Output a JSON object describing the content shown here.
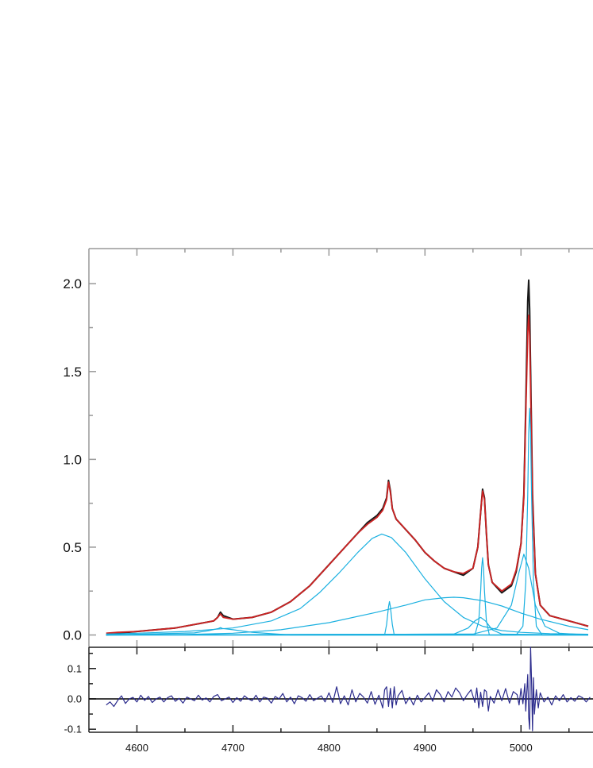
{
  "chart_data": [
    {
      "type": "line",
      "title": "",
      "xlabel": "",
      "ylabel": "",
      "xlim": [
        4550,
        5075
      ],
      "ylim": [
        -0.07,
        2.2
      ],
      "x_ticks": [
        4600,
        4700,
        4800,
        4900,
        5000
      ],
      "y_ticks": [
        0.0,
        0.5,
        1.0,
        1.5,
        2.0
      ],
      "y_tick_labels": [
        "0.0",
        "0.5",
        "1.0",
        "1.5",
        "2.0"
      ],
      "grid": false,
      "legend": "none",
      "series": [
        {
          "role": "observed",
          "color": "#1a1a1a",
          "x": [
            4568,
            4580,
            4600,
            4620,
            4640,
            4660,
            4680,
            4684,
            4687,
            4690,
            4700,
            4720,
            4740,
            4760,
            4780,
            4800,
            4820,
            4830,
            4840,
            4850,
            4856,
            4860,
            4862,
            4864,
            4866,
            4870,
            4880,
            4890,
            4900,
            4910,
            4920,
            4930,
            4940,
            4950,
            4955,
            4958,
            4960,
            4962,
            4964,
            4966,
            4970,
            4980,
            4990,
            4995,
            5000,
            5003,
            5005,
            5007,
            5008,
            5009,
            5010,
            5012,
            5015,
            5020,
            5030,
            5050,
            5070
          ],
          "y": [
            0.0,
            0.01,
            0.02,
            0.03,
            0.04,
            0.06,
            0.08,
            0.1,
            0.13,
            0.11,
            0.09,
            0.1,
            0.13,
            0.19,
            0.28,
            0.4,
            0.52,
            0.58,
            0.64,
            0.68,
            0.72,
            0.78,
            0.88,
            0.82,
            0.72,
            0.66,
            0.6,
            0.54,
            0.47,
            0.42,
            0.38,
            0.36,
            0.34,
            0.38,
            0.5,
            0.7,
            0.83,
            0.78,
            0.58,
            0.4,
            0.3,
            0.24,
            0.28,
            0.36,
            0.52,
            0.8,
            1.3,
            1.9,
            2.02,
            1.85,
            1.5,
            0.8,
            0.35,
            0.17,
            0.11,
            0.08,
            0.05
          ]
        },
        {
          "role": "fit",
          "color": "#cc2222",
          "x": [
            4568,
            4580,
            4600,
            4620,
            4640,
            4660,
            4680,
            4684,
            4687,
            4690,
            4700,
            4720,
            4740,
            4760,
            4780,
            4800,
            4820,
            4830,
            4840,
            4850,
            4856,
            4860,
            4862,
            4864,
            4866,
            4870,
            4880,
            4890,
            4900,
            4910,
            4920,
            4930,
            4940,
            4950,
            4955,
            4958,
            4960,
            4962,
            4964,
            4966,
            4970,
            4980,
            4990,
            4995,
            5000,
            5003,
            5005,
            5007,
            5008,
            5009,
            5010,
            5012,
            5015,
            5020,
            5030,
            5050,
            5070
          ],
          "y": [
            0.01,
            0.015,
            0.02,
            0.03,
            0.04,
            0.06,
            0.08,
            0.1,
            0.12,
            0.1,
            0.09,
            0.1,
            0.13,
            0.19,
            0.28,
            0.4,
            0.52,
            0.58,
            0.63,
            0.67,
            0.71,
            0.77,
            0.87,
            0.81,
            0.72,
            0.66,
            0.6,
            0.54,
            0.47,
            0.42,
            0.38,
            0.36,
            0.35,
            0.38,
            0.5,
            0.7,
            0.82,
            0.77,
            0.58,
            0.4,
            0.3,
            0.25,
            0.29,
            0.37,
            0.52,
            0.78,
            1.25,
            1.72,
            1.82,
            1.7,
            1.4,
            0.78,
            0.35,
            0.17,
            0.11,
            0.08,
            0.05
          ]
        },
        {
          "role": "component",
          "color": "#1ab0e0",
          "x": [
            4568,
            4600,
            4650,
            4700,
            4740,
            4770,
            4790,
            4810,
            4830,
            4845,
            4855,
            4865,
            4880,
            4900,
            4920,
            4940,
            4960,
            4980,
            5000,
            5030,
            5070
          ],
          "y": [
            0.005,
            0.01,
            0.02,
            0.04,
            0.08,
            0.15,
            0.24,
            0.35,
            0.47,
            0.55,
            0.575,
            0.555,
            0.47,
            0.32,
            0.19,
            0.1,
            0.05,
            0.025,
            0.015,
            0.008,
            0.004
          ]
        },
        {
          "role": "component",
          "color": "#1ab0e0",
          "x": [
            4568,
            4650,
            4700,
            4750,
            4800,
            4850,
            4880,
            4900,
            4920,
            4930,
            4940,
            4960,
            4980,
            5000,
            5020,
            5050,
            5070
          ],
          "y": [
            0.0,
            0.003,
            0.01,
            0.03,
            0.07,
            0.13,
            0.17,
            0.2,
            0.212,
            0.215,
            0.212,
            0.195,
            0.165,
            0.125,
            0.09,
            0.05,
            0.03
          ]
        },
        {
          "role": "component",
          "color": "#1ab0e0",
          "x": [
            4568,
            4660,
            4675,
            4685,
            4687,
            4689,
            4700,
            4720,
            4760,
            5070
          ],
          "y": [
            0.0,
            0.012,
            0.025,
            0.037,
            0.042,
            0.037,
            0.03,
            0.015,
            0.0,
            0.0
          ]
        },
        {
          "role": "component",
          "color": "#1ab0e0",
          "x": [
            4568,
            4858,
            4860,
            4862,
            4863,
            4864,
            4866,
            4868,
            5070
          ],
          "y": [
            0.0,
            0.0,
            0.06,
            0.16,
            0.19,
            0.16,
            0.06,
            0.0,
            0.0
          ]
        },
        {
          "role": "component",
          "color": "#1ab0e0",
          "x": [
            4568,
            4952,
            4956,
            4958,
            4959,
            4960,
            4961,
            4962,
            4964,
            4967,
            5070
          ],
          "y": [
            0.0,
            0.0,
            0.08,
            0.25,
            0.38,
            0.44,
            0.38,
            0.25,
            0.08,
            0.0,
            0.0
          ]
        },
        {
          "role": "component",
          "color": "#1ab0e0",
          "x": [
            4568,
            4930,
            4945,
            4952,
            4958,
            4963,
            4970,
            4980,
            5070
          ],
          "y": [
            0.0,
            0.005,
            0.04,
            0.08,
            0.1,
            0.08,
            0.03,
            0.005,
            0.0
          ]
        },
        {
          "role": "component",
          "color": "#1ab0e0",
          "x": [
            4568,
            4995,
            5002,
            5005,
            5007,
            5008,
            5009,
            5010,
            5011,
            5013,
            5016,
            5022,
            5070
          ],
          "y": [
            0.0,
            0.0,
            0.05,
            0.3,
            0.8,
            1.15,
            1.29,
            1.15,
            0.8,
            0.3,
            0.05,
            0.0,
            0.0
          ]
        },
        {
          "role": "component",
          "color": "#1ab0e0",
          "x": [
            4568,
            4950,
            4975,
            4990,
            4998,
            5003,
            5008,
            5015,
            5025,
            5040,
            5070
          ],
          "y": [
            0.0,
            0.005,
            0.04,
            0.17,
            0.36,
            0.46,
            0.38,
            0.17,
            0.05,
            0.01,
            0.0
          ]
        }
      ]
    },
    {
      "type": "line",
      "title": "",
      "xlabel": "",
      "ylabel": "",
      "xlim": [
        4550,
        5075
      ],
      "ylim": [
        -0.11,
        0.17
      ],
      "x_ticks": [
        4600,
        4700,
        4800,
        4900,
        5000
      ],
      "x_tick_labels": [
        "4600",
        "4700",
        "4800",
        "4900",
        "5000"
      ],
      "y_ticks": [
        -0.1,
        0.0,
        0.1
      ],
      "y_tick_labels": [
        "-0.1",
        "0.0",
        "0.1"
      ],
      "grid": false,
      "legend": "none",
      "series": [
        {
          "role": "zero-line",
          "color": "#000000",
          "x": [
            4550,
            5075
          ],
          "y": [
            0,
            0
          ]
        },
        {
          "role": "residual",
          "color": "#2a2a8c",
          "x": [
            4568,
            4572,
            4576,
            4580,
            4584,
            4588,
            4592,
            4596,
            4600,
            4604,
            4608,
            4612,
            4616,
            4620,
            4624,
            4628,
            4632,
            4636,
            4640,
            4644,
            4648,
            4652,
            4656,
            4660,
            4664,
            4668,
            4672,
            4676,
            4680,
            4684,
            4688,
            4692,
            4696,
            4700,
            4704,
            4708,
            4712,
            4716,
            4720,
            4724,
            4728,
            4732,
            4736,
            4740,
            4744,
            4748,
            4752,
            4756,
            4760,
            4764,
            4768,
            4772,
            4776,
            4780,
            4784,
            4788,
            4792,
            4796,
            4800,
            4804,
            4808,
            4812,
            4816,
            4820,
            4824,
            4828,
            4832,
            4836,
            4840,
            4844,
            4848,
            4852,
            4856,
            4858,
            4860,
            4862,
            4864,
            4866,
            4868,
            4870,
            4872,
            4876,
            4880,
            4884,
            4888,
            4892,
            4896,
            4900,
            4904,
            4908,
            4912,
            4916,
            4920,
            4924,
            4928,
            4932,
            4936,
            4940,
            4944,
            4948,
            4952,
            4954,
            4956,
            4958,
            4960,
            4962,
            4964,
            4966,
            4968,
            4972,
            4976,
            4980,
            4984,
            4988,
            4992,
            4996,
            4998,
            5000,
            5002,
            5004,
            5005,
            5006,
            5007,
            5008,
            5009,
            5010,
            5011,
            5012,
            5013,
            5014,
            5016,
            5018,
            5020,
            5024,
            5028,
            5032,
            5036,
            5040,
            5044,
            5048,
            5052,
            5056,
            5060,
            5064,
            5068,
            5072
          ],
          "y": [
            -0.02,
            -0.01,
            -0.025,
            -0.005,
            0.01,
            -0.015,
            0.0,
            0.005,
            -0.01,
            0.012,
            -0.005,
            0.008,
            -0.012,
            0.0,
            0.006,
            -0.01,
            0.004,
            0.01,
            -0.008,
            0.002,
            -0.014,
            0.006,
            0.0,
            -0.006,
            0.012,
            -0.004,
            0.003,
            -0.01,
            0.008,
            0.014,
            -0.006,
            0.0,
            0.006,
            -0.012,
            0.004,
            -0.008,
            0.01,
            0.0,
            -0.006,
            0.012,
            -0.01,
            0.006,
            0.002,
            -0.014,
            0.008,
            0.0,
            0.018,
            -0.01,
            0.006,
            -0.016,
            0.01,
            0.004,
            -0.008,
            0.014,
            -0.006,
            0.002,
            0.01,
            -0.01,
            0.02,
            -0.012,
            0.04,
            -0.016,
            0.01,
            -0.02,
            0.03,
            -0.01,
            0.018,
            0.006,
            -0.014,
            0.024,
            -0.018,
            0.012,
            -0.03,
            0.03,
            0.04,
            -0.025,
            0.035,
            -0.03,
            0.04,
            -0.02,
            0.01,
            0.028,
            -0.016,
            0.006,
            -0.02,
            0.012,
            -0.01,
            0.004,
            0.02,
            -0.008,
            0.03,
            0.014,
            -0.01,
            0.024,
            0.006,
            0.036,
            0.02,
            -0.006,
            0.014,
            0.03,
            -0.012,
            0.036,
            -0.03,
            0.022,
            -0.025,
            0.03,
            0.024,
            -0.04,
            0.008,
            -0.014,
            0.03,
            -0.006,
            0.034,
            -0.014,
            0.024,
            0.014,
            -0.02,
            0.034,
            -0.016,
            0.05,
            -0.04,
            0.02,
            0.08,
            -0.06,
            -0.1,
            0.17,
            0.06,
            -0.105,
            0.07,
            -0.05,
            0.03,
            -0.03,
            0.02,
            -0.01,
            0.006,
            -0.02,
            0.01,
            -0.006,
            0.014,
            -0.01,
            0.004,
            -0.008,
            0.01,
            0.004,
            -0.01,
            0.006
          ]
        }
      ]
    }
  ]
}
